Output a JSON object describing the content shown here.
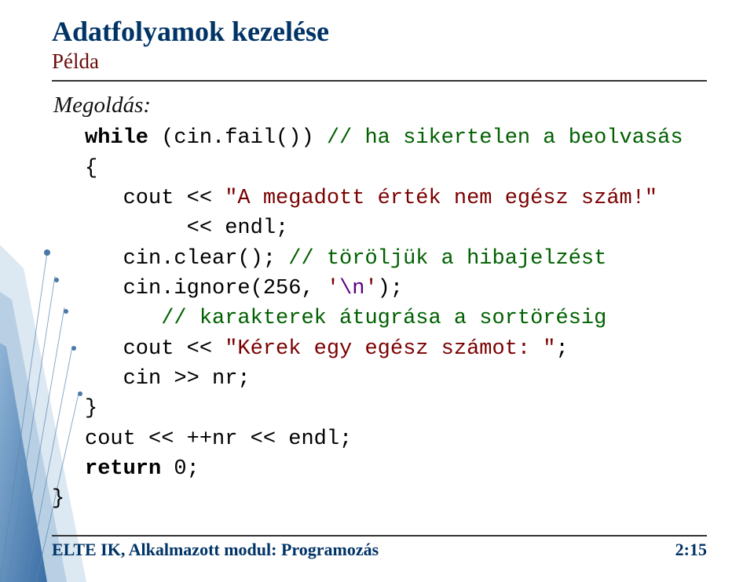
{
  "title": "Adatfolyamok kezelése",
  "subtitle": "Példa",
  "solution_label": "Megoldás:",
  "code": {
    "l1": {
      "kw": "while",
      "rest": " (cin.fail()) ",
      "cmt": "// ha sikertelen a beolvasás"
    },
    "l2": "{",
    "l3": {
      "a": "   cout << ",
      "str": "\"A megadott érték nem egész szám!\""
    },
    "l4": {
      "a": "        << endl;"
    },
    "l5": {
      "a": "   cin.clear(); ",
      "cmt": "// töröljük a hibajelzést"
    },
    "l6": {
      "a": "   cin.ignore(256, ",
      "q1": "'",
      "esc": "\\n",
      "q2": "'",
      "b": ");"
    },
    "l7": {
      "indent": "      ",
      "cmt": "// karakterek átugrása a sortörésig"
    },
    "l8": {
      "a": "   cout << ",
      "str": "\"Kérek egy egész számot: \"",
      "b": ";"
    },
    "l9": "   cin >> nr;",
    "l10": "}",
    "l11": "cout << ++nr << endl;",
    "l12": {
      "kw": "return",
      "rest": " 0;"
    },
    "l13": "}"
  },
  "footer": {
    "left": "ELTE IK, Alkalmazott modul: Programozás",
    "right": "2:15"
  }
}
